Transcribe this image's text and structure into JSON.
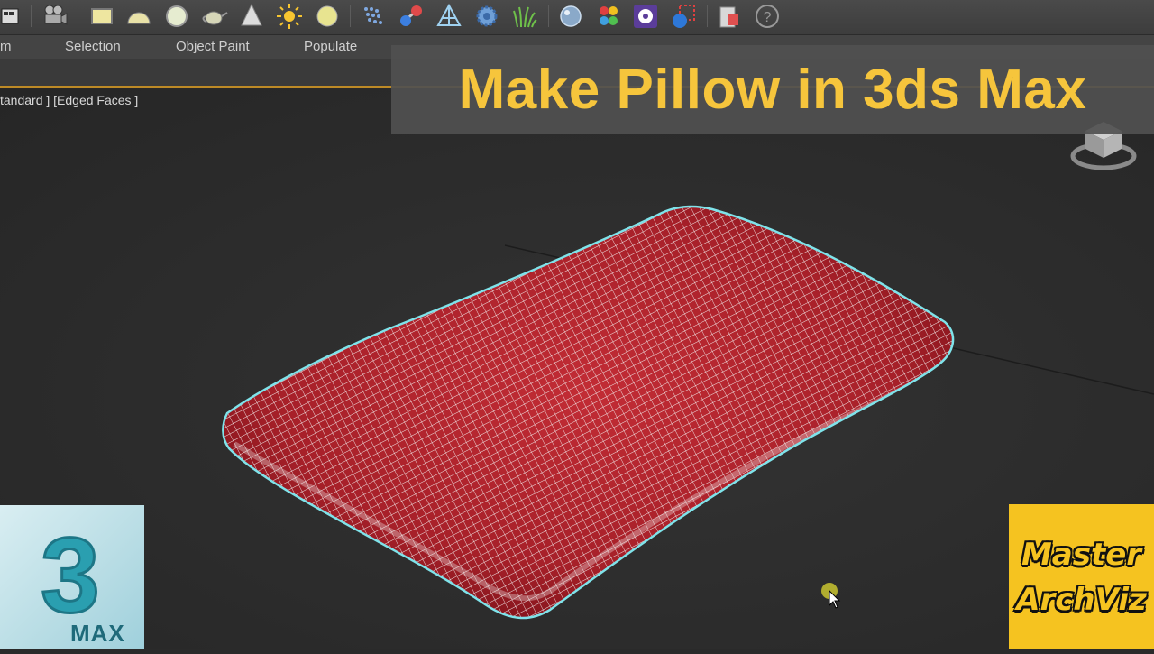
{
  "ribbon": {
    "tabs": [
      "m",
      "Selection",
      "Object Paint",
      "Populate"
    ]
  },
  "viewport": {
    "label": "tandard ] [Edged Faces ]"
  },
  "banner": {
    "title": "Make Pillow in 3ds Max"
  },
  "logo_3ds": {
    "number": "3",
    "text": "MAX"
  },
  "archviz_logo": {
    "line1": "Master",
    "line2": "ArchViz"
  },
  "toolbar": {
    "icons": [
      "render-setup-icon",
      "camera-icon",
      "plane-icon",
      "hemisphere-icon",
      "sphere-icon",
      "teapot-icon",
      "cone-icon",
      "sun-icon",
      "light-icon",
      "particles-icon",
      "molecule-icon",
      "bones-icon",
      "gear-icon",
      "grass-icon",
      "material-sphere-icon",
      "color-palette-icon",
      "paint-icon",
      "render-frame-icon",
      "clipboard-icon",
      "help-icon"
    ]
  },
  "colors": {
    "pillow_fill": "#b3262e",
    "wire": "#f0e8e8",
    "selection_outline": "#7fe3ea",
    "banner_text": "#f6c53c",
    "ribbon_accent": "#bd8a26",
    "archviz_bg": "#f5c320"
  }
}
